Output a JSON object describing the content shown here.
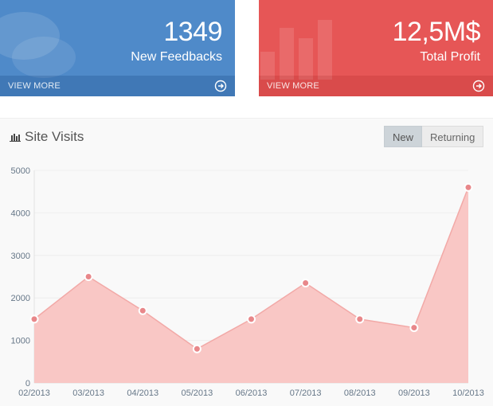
{
  "cards": [
    {
      "value": "1349",
      "label": "New Feedbacks",
      "link": "VIEW MORE",
      "icon": "arrow-circle-right-icon",
      "color": "#4f8ac9"
    },
    {
      "value": "12,5M$",
      "label": "Total Profit",
      "link": "VIEW MORE",
      "icon": "arrow-circle-right-icon",
      "color": "#e65656"
    }
  ],
  "panel": {
    "title": "Site Visits",
    "title_icon": "bar-chart-icon",
    "tabs": [
      {
        "label": "New",
        "active": true
      },
      {
        "label": "Returning",
        "active": false
      }
    ]
  },
  "chart_data": {
    "type": "area",
    "title": "Site Visits",
    "categories": [
      "02/2013",
      "03/2013",
      "04/2013",
      "05/2013",
      "06/2013",
      "07/2013",
      "08/2013",
      "09/2013",
      "10/2013"
    ],
    "series": [
      {
        "values": [
          1500,
          2500,
          1700,
          800,
          1500,
          2350,
          1500,
          1300,
          4600
        ],
        "color": "#f9c4c2"
      }
    ],
    "yticks": [
      "5000",
      "4000",
      "3000",
      "2000",
      "1000",
      "0"
    ],
    "ylim": [
      0,
      5000
    ],
    "grid": true
  }
}
